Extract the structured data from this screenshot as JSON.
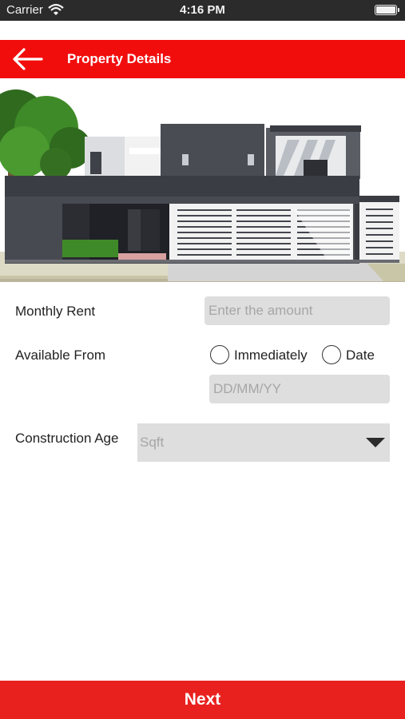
{
  "status_bar": {
    "carrier": "Carrier",
    "time": "4:16 PM"
  },
  "header": {
    "title": "Property Details",
    "back_icon": "arrow-left-icon"
  },
  "form": {
    "monthly_rent": {
      "label": "Monthly Rent",
      "placeholder": "Enter the amount"
    },
    "available_from": {
      "label": "Available From",
      "options": [
        "Immediately",
        "Date"
      ],
      "date_placeholder": "DD/MM/YY"
    },
    "construction_age": {
      "label": "Construction Age",
      "selected": "Sqft"
    }
  },
  "footer": {
    "next_label": "Next"
  },
  "colors": {
    "header_red": "#f20d0d",
    "button_red": "#e8211f",
    "field_gray": "#dedede"
  }
}
